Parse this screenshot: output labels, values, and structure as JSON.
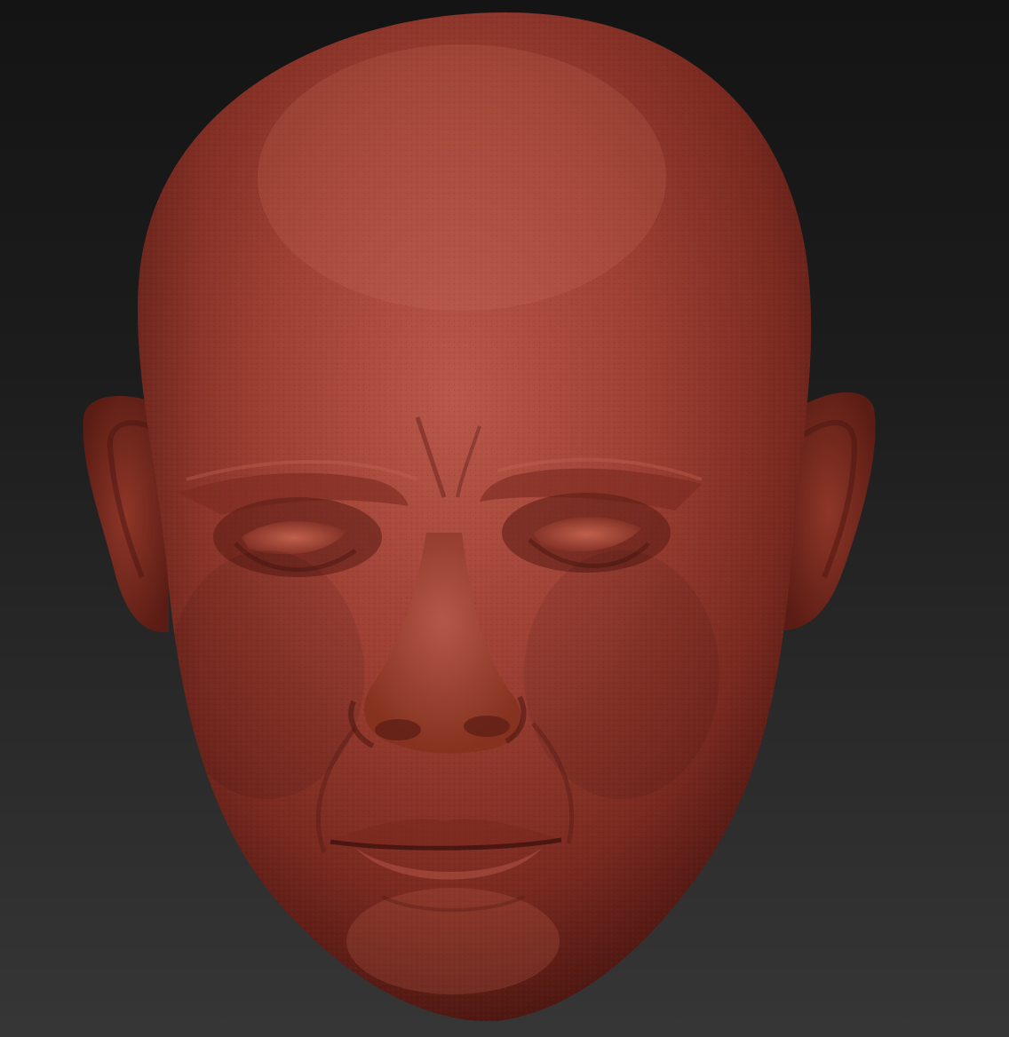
{
  "viewport": {
    "background_top": "#141414",
    "background_bottom": "#363636"
  },
  "model": {
    "subject": "sculpted-bald-male-head",
    "material_color": "#9a3a2c",
    "material_highlight": "#c0604c",
    "material_shadow": "#4a1610"
  }
}
